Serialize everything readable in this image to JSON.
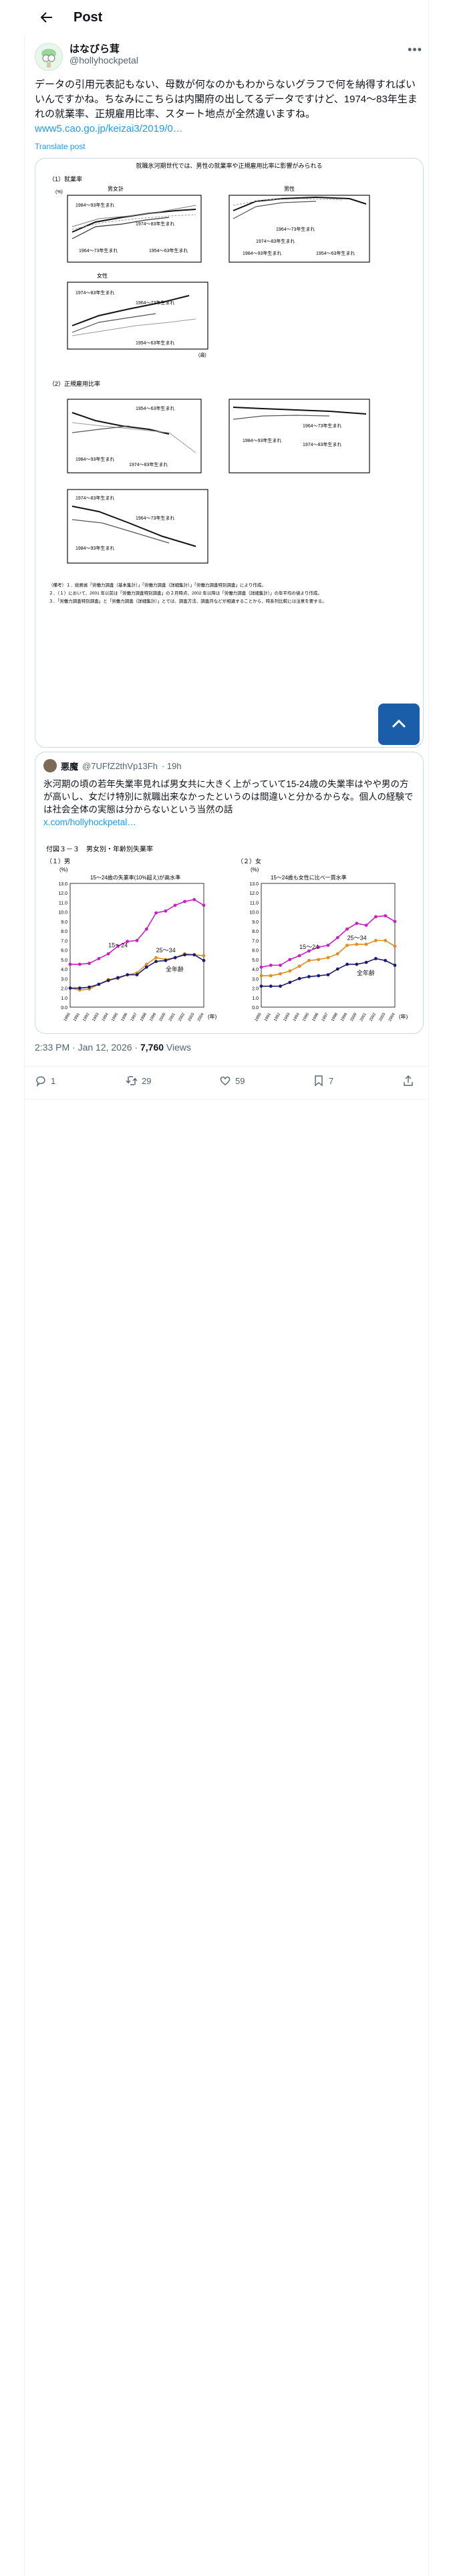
{
  "header": {
    "title": "Post"
  },
  "author": {
    "name": "はなびら茸",
    "handle": "@hollyhockpetal"
  },
  "tweet": {
    "text": "データの引用元表記もない、母数が何なのかもわからないグラフで何を納得すればいいんですかね。ちなみにこちらは内閣府の出してるデータですけど、1974～83年生まれの就業率、正規雇用比率、スタート地点が全然違いますね。",
    "link": "www5.cao.go.jp/keizai3/2019/0…",
    "translate": "Translate post"
  },
  "figure": {
    "title": "就職氷河期世代では、男性の就業率や正規雇用比率に影響がみられる",
    "sec1": "（1）就業率",
    "sec2": "（2）正規雇用比率",
    "panel_all": "男女計",
    "panel_male": "男性",
    "panel_female": "女性",
    "pct": "(%)",
    "age_unit": "(歳)",
    "legend_a": "1984～93年生まれ",
    "legend_b": "1974～83年生まれ",
    "legend_c": "1964～73年生まれ",
    "legend_d": "1954～63年生まれ",
    "note1": "（備考）１．総務省「労働力調査（基本集計）」「労働力調査（詳細集計）」「労働力調査特別調査」により作成。",
    "note2": "２．（１）において、2001 年以前は「労働力調査特別調査」の２月時点、2002 年以降は「労働力調査（詳細集計）」の年平均の値より作成。",
    "note3": "３．「労働力調査特別調査」と「労働力調査（詳細集計）」とでは、調査方法、調査月などが相違することから、時系列比較には注意を要する。"
  },
  "quote": {
    "name": "悪魔",
    "handle": "@7UFfZ2thVp13Fh",
    "time": "· 19h",
    "text": "氷河期の頃の若年失業率見れば男女共に大きく上がっていて15-24歳の失業率はやや男の方が高いし、女だけ特別に就職出来なかったというのは間違いと分かるからな。個人の経験では社会全体の実態は分からないという当然の話",
    "link": "x.com/hollyhockpetal…"
  },
  "quote_chart": {
    "title": "付図３－３　男女別・年齢別失業率",
    "male_label": "（１）男",
    "female_label": "（２）女",
    "male_caption": "15～24歳の失業率(10%超え)が高水準",
    "female_caption": "15～24歳も女性に比べ一貫水準",
    "series_young": "15～24",
    "series_mid": "25～34",
    "series_all": "全年齢",
    "y_unit": "(%)",
    "x_unit": "(年)"
  },
  "meta": {
    "time": "2:33 PM · Jan 12, 2026 · ",
    "views": "7,760",
    "views_label": " Views"
  },
  "actions": {
    "replies": "1",
    "reposts": "29",
    "likes": "59",
    "bookmarks": "7"
  },
  "colors": {
    "accent": "#1d9bf0",
    "young": "#c81ec8",
    "mid": "#e08c1e",
    "all": "#1a1a6e"
  },
  "chart_data": [
    {
      "type": "line",
      "title": "付図３－３　男女別・年齢別失業率（１）男",
      "x": [
        1990,
        1991,
        1992,
        1993,
        1994,
        1995,
        1996,
        1997,
        1998,
        1999,
        2000,
        2001,
        2002,
        2003,
        2004
      ],
      "series": [
        {
          "name": "15～24",
          "values": [
            4.5,
            4.5,
            4.6,
            5.1,
            5.6,
            6.4,
            6.9,
            7.0,
            8.2,
            9.9,
            10.1,
            10.7,
            11.1,
            11.3,
            10.7
          ]
        },
        {
          "name": "25～34",
          "values": [
            2.0,
            1.8,
            1.9,
            2.4,
            2.9,
            3.0,
            3.4,
            3.6,
            4.5,
            5.2,
            5.0,
            5.2,
            5.6,
            5.5,
            5.4
          ]
        },
        {
          "name": "全年齢",
          "values": [
            2.0,
            2.0,
            2.1,
            2.4,
            2.8,
            3.1,
            3.4,
            3.4,
            4.2,
            4.8,
            4.9,
            5.2,
            5.5,
            5.5,
            4.9
          ]
        }
      ],
      "ylabel": "(%)",
      "ylim": [
        0,
        13
      ]
    },
    {
      "type": "line",
      "title": "付図３－３　男女別・年齢別失業率（２）女",
      "x": [
        1990,
        1991,
        1992,
        1993,
        1994,
        1995,
        1996,
        1997,
        1998,
        1999,
        2000,
        2001,
        2002,
        2003,
        2004
      ],
      "series": [
        {
          "name": "15～24",
          "values": [
            4.2,
            4.4,
            4.4,
            5.0,
            5.4,
            5.9,
            6.3,
            6.5,
            7.3,
            8.2,
            8.8,
            8.6,
            9.5,
            9.6,
            9.0
          ]
        },
        {
          "name": "25～34",
          "values": [
            3.3,
            3.3,
            3.5,
            3.8,
            4.3,
            4.9,
            5.0,
            5.2,
            5.6,
            6.5,
            6.6,
            6.6,
            7.0,
            7.0,
            6.4
          ]
        },
        {
          "name": "全年齢",
          "values": [
            2.2,
            2.2,
            2.2,
            2.6,
            3.0,
            3.2,
            3.3,
            3.4,
            4.0,
            4.5,
            4.5,
            4.7,
            5.1,
            4.9,
            4.4
          ]
        }
      ],
      "ylabel": "(%)",
      "ylim": [
        0,
        13
      ]
    }
  ]
}
